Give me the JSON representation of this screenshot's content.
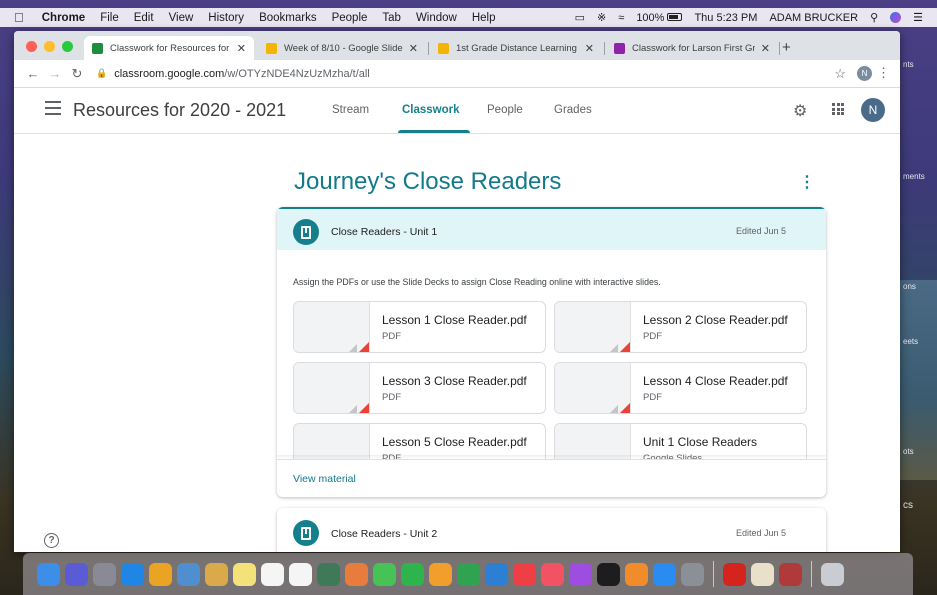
{
  "menubar": {
    "app": "Chrome",
    "items": [
      "File",
      "Edit",
      "View",
      "History",
      "Bookmarks",
      "People",
      "Tab",
      "Window",
      "Help"
    ],
    "battery": "100%",
    "clock": "Thu 5:23 PM",
    "user": "ADAM BRUCKER"
  },
  "desktop_labels": [
    "nts",
    "ments",
    "ons",
    "eets",
    "ots",
    "cs"
  ],
  "browser": {
    "tabs": [
      {
        "title": "Classwork for Resources for 20",
        "favicon_color": "#1e8e3e",
        "active": true
      },
      {
        "title": "Week of 8/10 - Google Slides",
        "favicon_color": "#f4b400",
        "active": false
      },
      {
        "title": "1st Grade Distance Learning - ",
        "favicon_color": "#f4b400",
        "active": false
      },
      {
        "title": "Classwork for Larson First Grac",
        "favicon_color": "#8e24aa",
        "active": false
      }
    ],
    "url_host": "classroom.google.com",
    "url_path": "/w/OTYzNDE4NzUzMzha/t/all",
    "profile_initial": "N"
  },
  "classroom": {
    "class_name": "Resources for 2020 - 2021",
    "nav_tabs": [
      "Stream",
      "Classwork",
      "People",
      "Grades"
    ],
    "active_tab": "Classwork",
    "avatar_initial": "N",
    "accent_color": "#15808c"
  },
  "topic": {
    "title": "Journey's Close Readers"
  },
  "material": {
    "title": "Close Readers - Unit 1",
    "edited": "Edited Jun 5",
    "description": "Assign the PDFs or use the Slide Decks to assign Close Reading online with interactive slides.",
    "attachments": [
      {
        "name": "Lesson 1 Close Reader.pdf",
        "type": "PDF"
      },
      {
        "name": "Lesson 2 Close Reader.pdf",
        "type": "PDF"
      },
      {
        "name": "Lesson 3 Close Reader.pdf",
        "type": "PDF"
      },
      {
        "name": "Lesson 4 Close Reader.pdf",
        "type": "PDF"
      },
      {
        "name": "Lesson 5 Close Reader.pdf",
        "type": "PDF"
      },
      {
        "name": "Unit 1 Close Readers",
        "type": "Google Slides"
      }
    ],
    "view_link": "View material"
  },
  "material2": {
    "title": "Close Readers - Unit 2",
    "edited": "Edited Jun 5"
  },
  "help_label": "?",
  "dock": {
    "apps": [
      {
        "name": "Finder",
        "color": "#3d8ee8"
      },
      {
        "name": "Siri",
        "color": "#5b5bd6"
      },
      {
        "name": "Launchpad",
        "color": "#8a8a96"
      },
      {
        "name": "Safari",
        "color": "#1f86e6"
      },
      {
        "name": "Chrome",
        "color": "#e9a423"
      },
      {
        "name": "Preview",
        "color": "#4f8fd0"
      },
      {
        "name": "Notes",
        "color": "#d9a94a"
      },
      {
        "name": "Stickies",
        "color": "#f3e27a"
      },
      {
        "name": "Calendar",
        "color": "#f5f5f5"
      },
      {
        "name": "Reminders",
        "color": "#f5f5f5"
      },
      {
        "name": "Photo Booth",
        "color": "#3e7a58"
      },
      {
        "name": "Photos",
        "color": "#e77c3c"
      },
      {
        "name": "Messages",
        "color": "#47c256"
      },
      {
        "name": "FaceTime",
        "color": "#2fb34c"
      },
      {
        "name": "Pages",
        "color": "#f29e2d"
      },
      {
        "name": "Numbers",
        "color": "#2fa34f"
      },
      {
        "name": "Keynote",
        "color": "#2d7fd4"
      },
      {
        "name": "News",
        "color": "#ef3f46"
      },
      {
        "name": "Music",
        "color": "#f25364"
      },
      {
        "name": "Podcasts",
        "color": "#9d4ee0"
      },
      {
        "name": "TV",
        "color": "#1d1d1f"
      },
      {
        "name": "Books",
        "color": "#f08d2a"
      },
      {
        "name": "App Store",
        "color": "#2a8cf0"
      },
      {
        "name": "System Preferences",
        "color": "#8b8f96"
      },
      {
        "name": "Acrobat",
        "color": "#d5231e"
      },
      {
        "name": "Files",
        "color": "#e8e0c9"
      },
      {
        "name": "Dictionary",
        "color": "#b03a3a"
      },
      {
        "name": "Trash",
        "color": "#c9ccd2"
      }
    ]
  }
}
